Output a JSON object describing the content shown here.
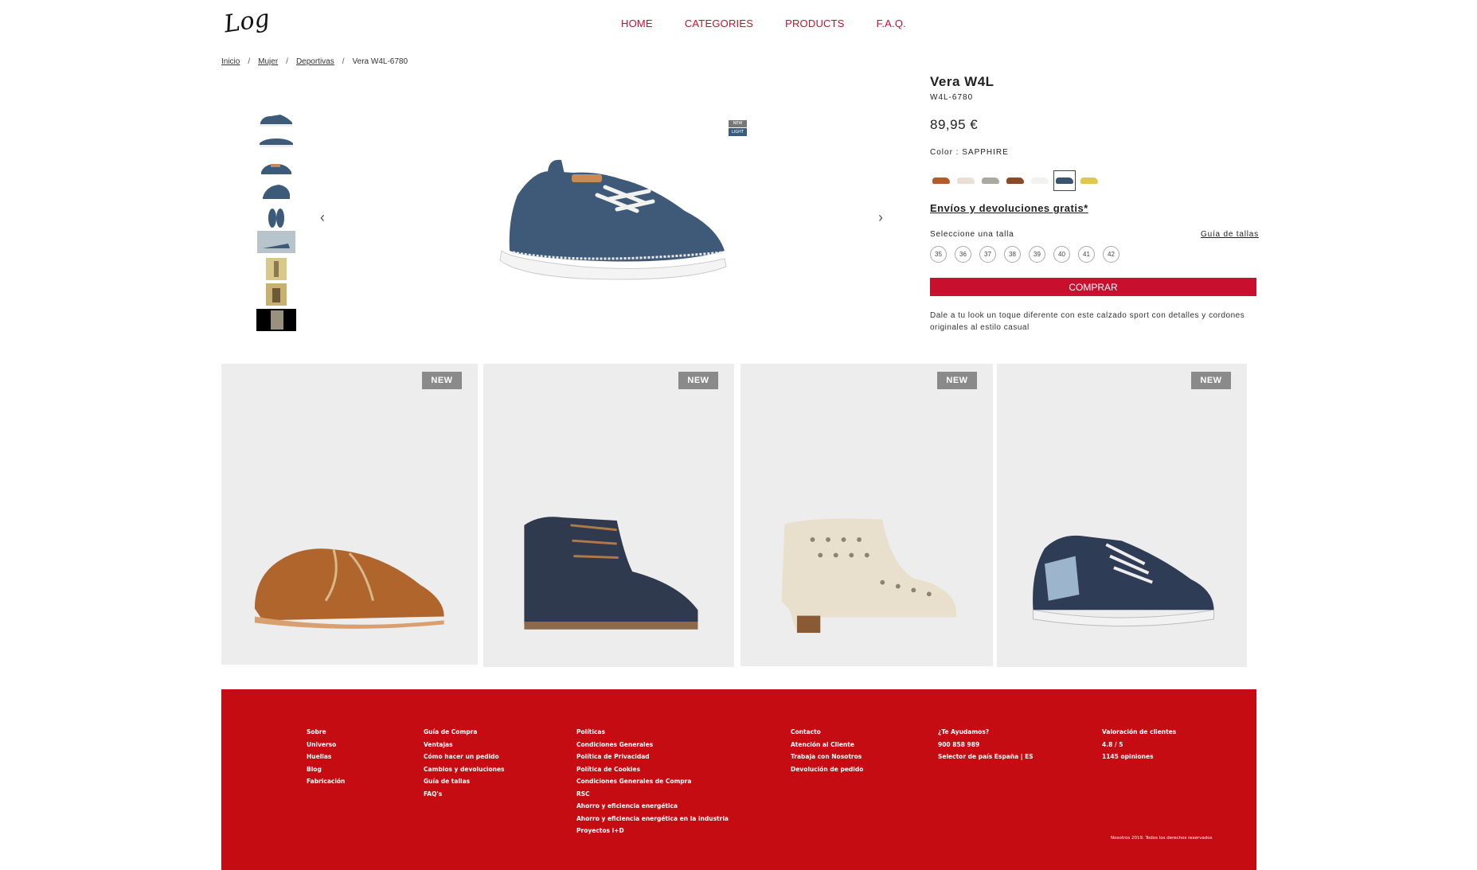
{
  "header": {
    "logo_text": "Logo",
    "nav": [
      "HOME",
      "CATEGORIES",
      "PRODUCTS",
      "F.A.Q."
    ]
  },
  "breadcrumb": {
    "items": [
      "Inicio",
      "Mujer",
      "Deportivas"
    ],
    "current": "Vera W4L-6780"
  },
  "gallery": {
    "badge_new": "NEW",
    "badge_light": "LIGHT",
    "thumbnail_count": 9
  },
  "product": {
    "name": "Vera W4L",
    "sku": "W4L-6780",
    "price": "89,95 €",
    "color_label": "Color : SAPPHIRE",
    "swatches": [
      "#b65a2c",
      "#eadfd4",
      "#a9a9a0",
      "#8a4a28",
      "#f2f2ee",
      "#3a5570",
      "#e2c84a"
    ],
    "selected_swatch": 5,
    "shipping": "Envíos y devoluciones gratis*",
    "size_label": "Seleccione una talla",
    "size_guide": "Guía de tallas",
    "sizes": [
      "35",
      "36",
      "37",
      "38",
      "39",
      "40",
      "41",
      "42"
    ],
    "buy_label": "COMPRAR",
    "description": "Dale a tu look un toque diferente con este calzado sport con detalles y cordones originales al estilo casual"
  },
  "related": {
    "badge": "NEW",
    "items": [
      {
        "name": "brown-oxford"
      },
      {
        "name": "navy-brogue-boot"
      },
      {
        "name": "perforated-ankle-boot"
      },
      {
        "name": "navy-zip-sneaker"
      }
    ]
  },
  "footer": {
    "col1": [
      "Sobre",
      "Universo",
      "Huellas",
      "Blog",
      "Fabricación"
    ],
    "col2": [
      "Guía de Compra",
      "Ventajas",
      "Cómo hacer un pedido",
      "Cambios y devoluciones",
      "Guía de tallas",
      "FAQ's"
    ],
    "col3": [
      "Políticas",
      "Condiciones Generales",
      "Política de Privacidad",
      "Política de Cookies",
      "Condiciones Generales de Compra",
      "RSC",
      "Ahorro y eficiencia energética",
      "Ahorro y eficiencia energética en la industria",
      "Proyectos i+D"
    ],
    "col4": [
      "Contacto",
      "Atención al Cliente",
      "Trabaja con Nosotros",
      "Devolución de pedido"
    ],
    "col5": [
      "¿Te Ayudamos?",
      "900 858 989",
      "Selector de país España | ES"
    ],
    "col6": [
      "Valoración de clientes",
      "4.8 / 5",
      "1145 opiniones"
    ],
    "copyright": "Nosotros 2019. Todos los derechos reservados"
  }
}
